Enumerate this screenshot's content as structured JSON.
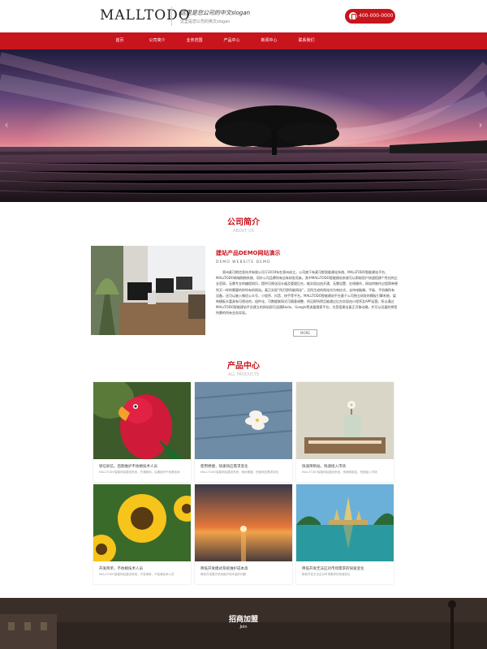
{
  "header": {
    "logo": "MALLTODO",
    "slogan": "这里是您公司的中文slogan",
    "slogan_sub": "这里是您公司的英文slogan",
    "phone": "400-000-0000"
  },
  "nav": {
    "items": [
      "首页",
      "公司简介",
      "业务范围",
      "产品中心",
      "新闻中心",
      "联系我们"
    ]
  },
  "about": {
    "title": "公司简介",
    "subtitle": "ABOUT US",
    "heading": "建站产品DEMO网站演示",
    "heading_en": "DEMO WEBSITE DEMO",
    "body": "郑州麦可斯信息技术有限公司于2019年在郑州成立。公司旗下有麦可斯智能建站系统、MALLTODO智能建站平台、MALLTODO商城购物系统、同外公司品牌所有自有研发而来。其中MALLTODO智能建站系统可以帮助用户快速搭建个性化的企业官网，无需专业的编程知识，提供可视化设计器及管理后台，能实现自由开通、无需设置、在线操作，网站的制作过程简单便利又一样的需要的你所有的网站。真正实现“所打即所能网站”，且所生成的网站均为响应式，支持电脑端、平板、手机端所有设备，还可以嵌入微信公众号、小程序、抖音、快手等平台。MALLTODO智能建站平台基于公司独立研发的模板引擎系统，架构模板丰富具有可视化的，组件化，可数据联网式可随意调整，所见即所得且能通过后台实现由小程序及APP运营。所以通过MALLTODO智能建站平台建立的网站即可迎通Baidu、Google等流量搜索平台，为您搭建出真正可移动端，并可以迅速的将您所需的所有业务实现。",
    "more": "MORE"
  },
  "products": {
    "title": "产品中心",
    "subtitle": "ALL PRODUCTS",
    "items": [
      {
        "title": "够信如信，后期维护不依赖技术人员",
        "desc": "MALLTODO智能网站建设系统，开通即用，后期维护不依赖技术"
      },
      {
        "title": "使用便捷，快速响应需求变化",
        "desc": "MALLTODO智能网站建设系统，使用便捷，快速响应需求变化"
      },
      {
        "title": "快速简制站，快速接入市场",
        "desc": "MALLTODO智能网站建设系统，快速简制站，快速接入市场"
      },
      {
        "title": "开发简单，不依赖技术人员",
        "desc": "MALLTODO智能网站建设系统，开发简单，不依赖技术人员"
      },
      {
        "title": "降低开发模式系统维护成本高",
        "desc": "降低开发模式系统维护成本高的问题"
      },
      {
        "title": "降低开发无法应对市场需求的快速变化",
        "desc": "降低开发无法应对市场需求的快速变化"
      }
    ]
  },
  "join": {
    "title": "招商加盟",
    "subtitle": "Join"
  },
  "colors": {
    "brand": "#c8141c"
  }
}
